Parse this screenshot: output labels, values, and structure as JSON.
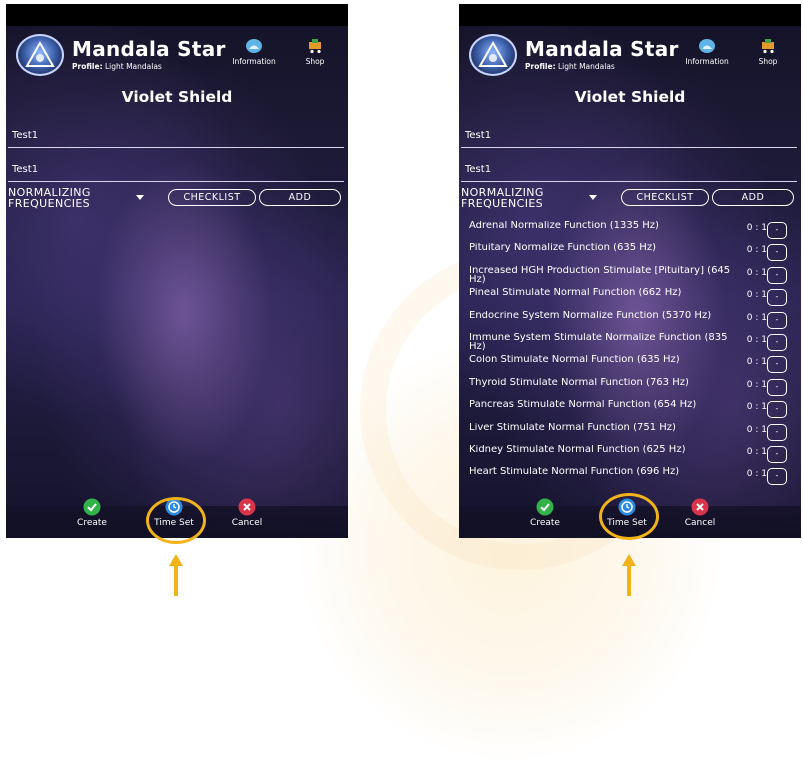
{
  "colors": {
    "accent_highlight": "#f2b31a",
    "panel_bg": "#1c1934",
    "create_green": "#33b249",
    "timeset_blue": "#2a8be0",
    "cancel_red": "#d9344a"
  },
  "screens": [
    {
      "app_title": "Mandala Star",
      "profile_label": "Profile:",
      "profile_value": "Light Mandalas",
      "info_label": "Information",
      "shop_label": "Shop",
      "page_title": "Violet Shield",
      "field1": "Test1",
      "field2": "Test1",
      "dropdown_value": "NORMALIZING FREQUENCIES",
      "checklist_label": "CHECKLIST",
      "add_label": "ADD",
      "create_label": "Create",
      "timeset_label": "Time Set",
      "cancel_label": "Cancel"
    },
    {
      "app_title": "Mandala Star",
      "profile_label": "Profile:",
      "profile_value": "Light Mandalas",
      "info_label": "Information",
      "shop_label": "Shop",
      "page_title": "Violet Shield",
      "field1": "Test1",
      "field2": "Test1",
      "dropdown_value": "NORMALIZING FREQUENCIES",
      "checklist_label": "CHECKLIST",
      "add_label": "ADD",
      "create_label": "Create",
      "timeset_label": "Time Set",
      "cancel_label": "Cancel",
      "frequencies": [
        {
          "name": "Adrenal Normalize Function (1335 Hz)",
          "ratio": "0 : 1",
          "box": "-"
        },
        {
          "name": "Pituitary Normalize Function (635 Hz)",
          "ratio": "0 : 1",
          "box": "-"
        },
        {
          "name": "Increased HGH Production Stimulate [Pituitary] (645 Hz)",
          "ratio": "0 : 1",
          "box": "-"
        },
        {
          "name": "Pineal Stimulate Normal Function (662 Hz)",
          "ratio": "0 : 1",
          "box": "-"
        },
        {
          "name": "Endocrine System Normalize Function (5370 Hz)",
          "ratio": "0 : 1",
          "box": "-"
        },
        {
          "name": "Immune System Stimulate Normalize Function (835 Hz)",
          "ratio": "0 : 1",
          "box": "-"
        },
        {
          "name": "Colon Stimulate Normal Function (635 Hz)",
          "ratio": "0 : 1",
          "box": "-"
        },
        {
          "name": "Thyroid Stimulate Normal Function (763 Hz)",
          "ratio": "0 : 1",
          "box": "-"
        },
        {
          "name": "Pancreas Stimulate Normal Function (654 Hz)",
          "ratio": "0 : 1",
          "box": "-"
        },
        {
          "name": "Liver Stimulate Normal Function (751 Hz)",
          "ratio": "0 : 1",
          "box": "-"
        },
        {
          "name": "Kidney Stimulate Normal Function (625 Hz)",
          "ratio": "0 : 1",
          "box": "-"
        },
        {
          "name": "Heart Stimulate Normal Function (696 Hz)",
          "ratio": "0 : 1",
          "box": "-"
        }
      ]
    }
  ]
}
